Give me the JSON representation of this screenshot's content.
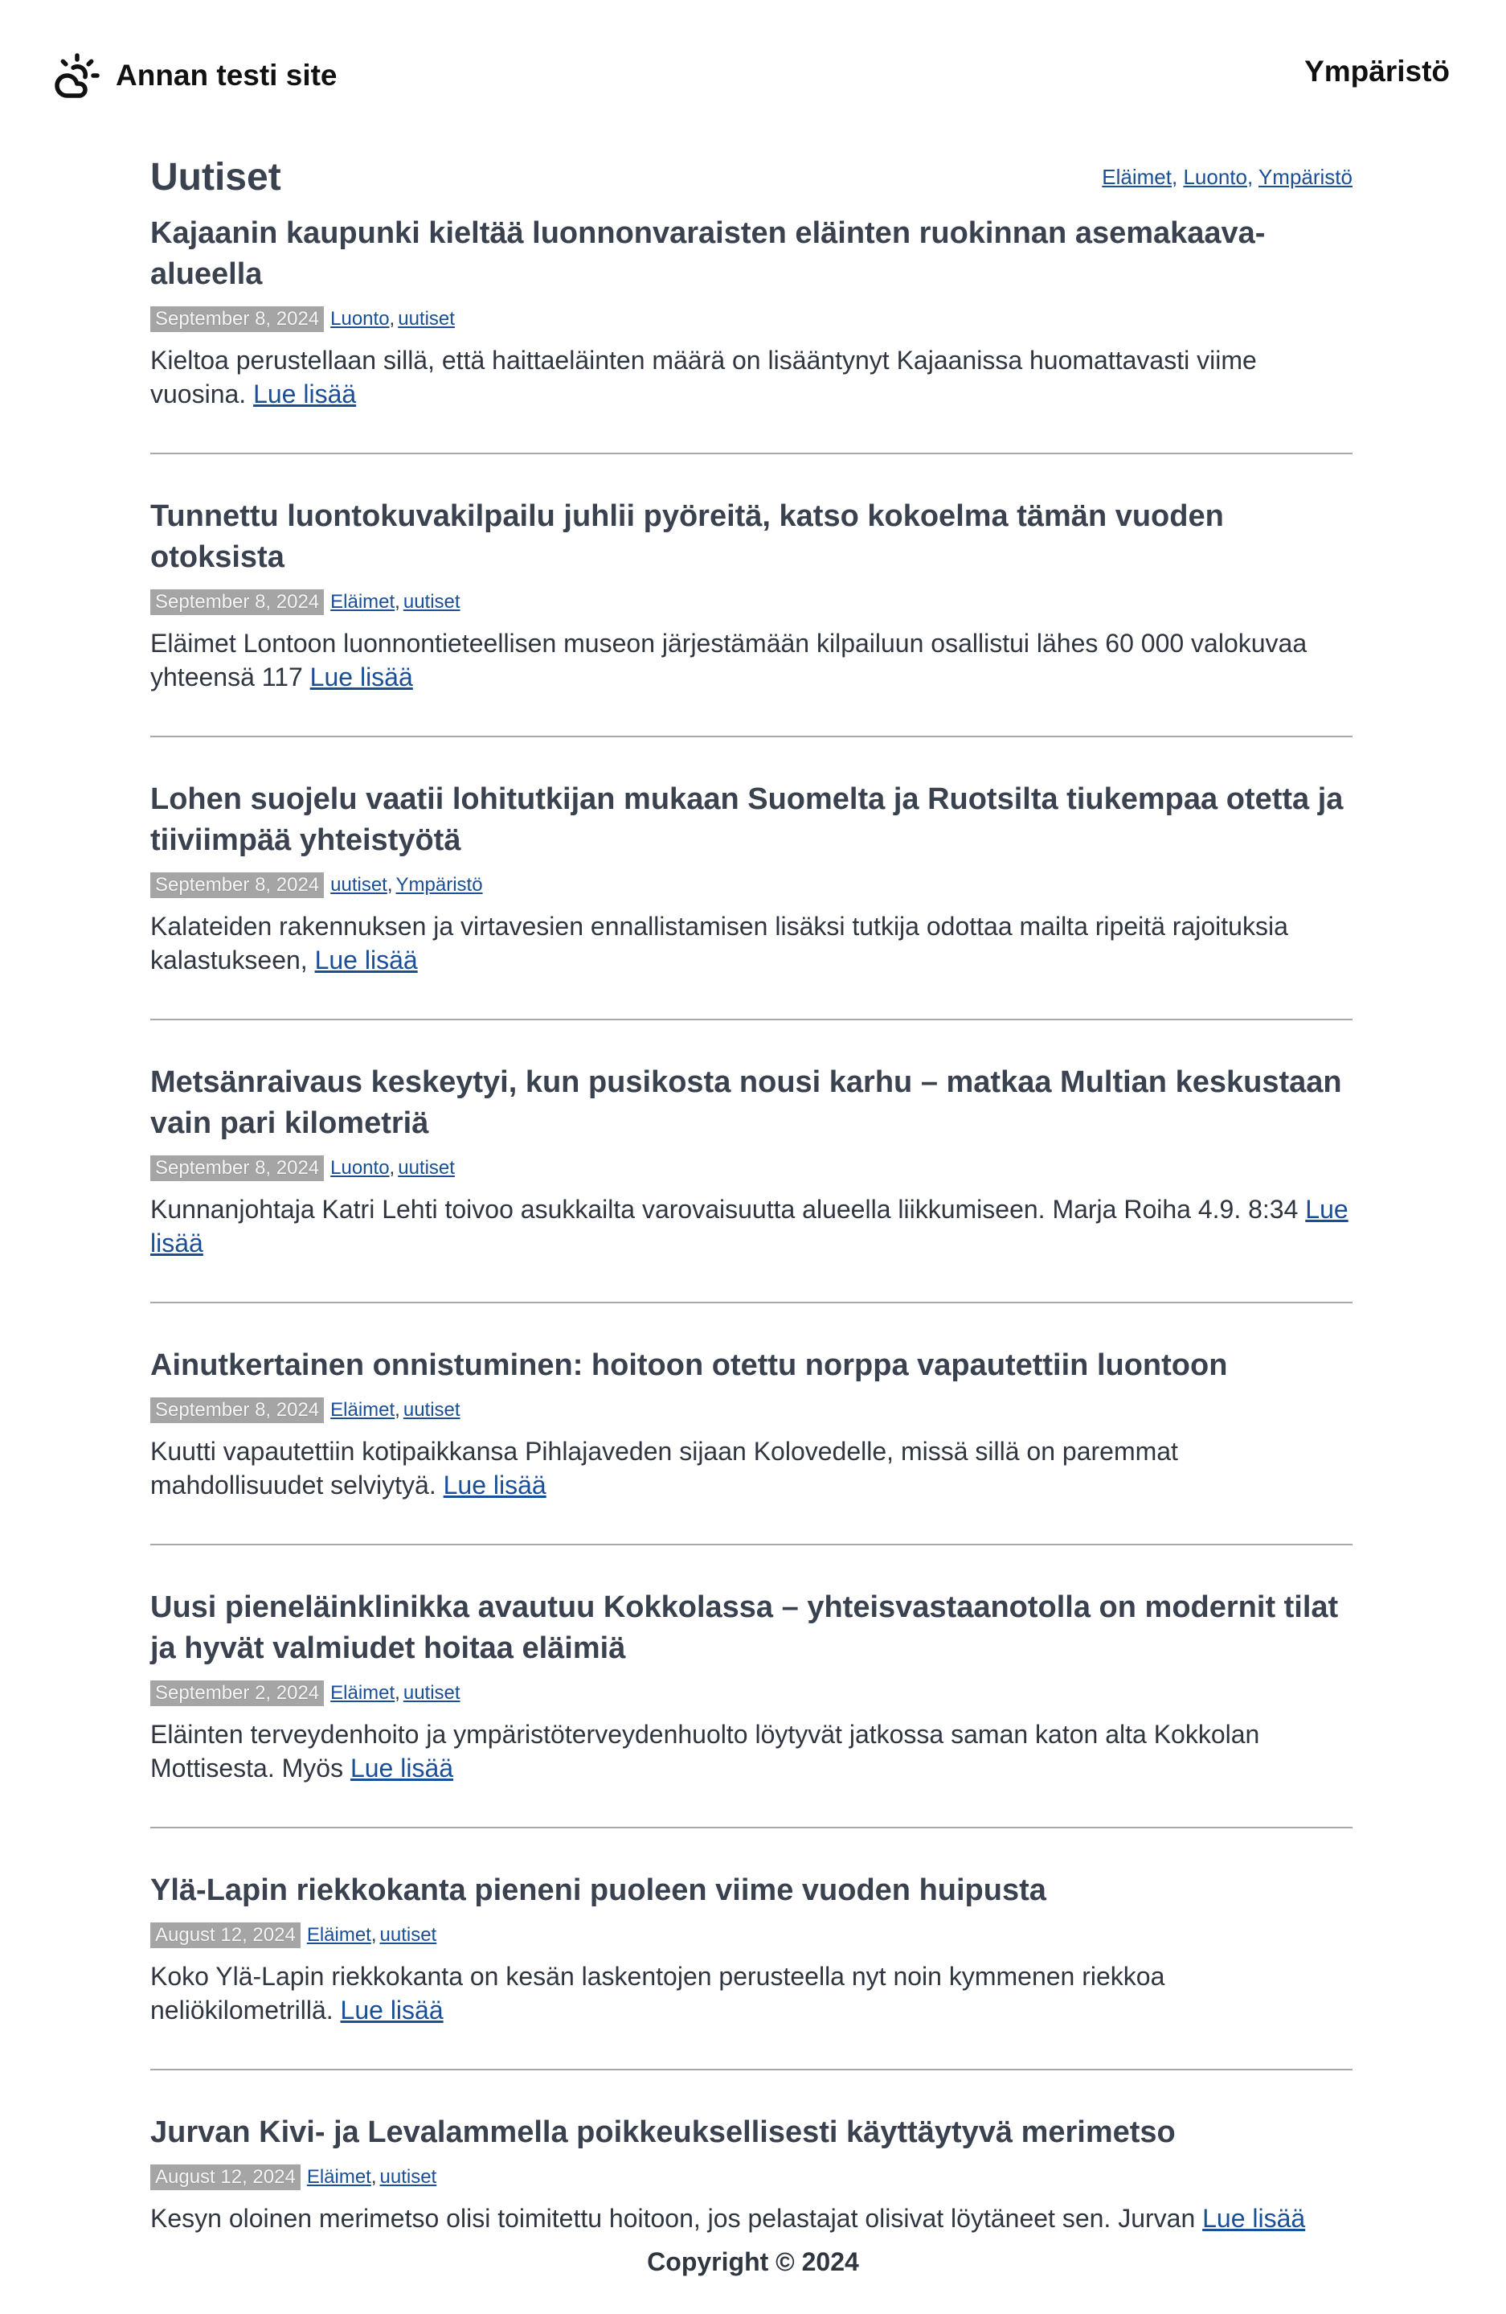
{
  "header": {
    "site_name": "Annan testi site",
    "logo_icon": "cloud-sun-icon",
    "nav_label": "Ympäristö"
  },
  "page": {
    "title": "Uutiset",
    "tags": [
      "Eläimet",
      "Luonto",
      "Ympäristö"
    ]
  },
  "read_more_label": "Lue lisää",
  "posts": [
    {
      "title": "Kajaanin kaupunki kieltää luonnonvaraisten eläinten ruokinnan asemakaava-alueella",
      "date": "September 8, 2024",
      "tags": [
        "Luonto",
        "uutiset"
      ],
      "excerpt": "Kieltoa perustellaan sillä, että haittaeläinten määrä on lisääntynyt Kajaanissa huomattavasti viime vuosina."
    },
    {
      "title": "Tunnettu luontokuvakilpailu juhlii pyöreitä, katso kokoelma tämän vuoden otoksista",
      "date": "September 8, 2024",
      "tags": [
        "Eläimet",
        "uutiset"
      ],
      "excerpt": "Eläimet Lontoon luonnontieteellisen museon järjestämään kilpailuun osallistui lähes 60 000 valokuvaa yhteensä 117"
    },
    {
      "title": "Lohen suojelu vaatii lohitutkijan mukaan Suomelta ja Ruotsilta tiukempaa otetta ja tiiviimpää yhteistyötä",
      "date": "September 8, 2024",
      "tags": [
        "uutiset",
        "Ympäristö"
      ],
      "excerpt": "Kalateiden rakennuksen ja virtavesien ennallistamisen lisäksi tutkija odottaa mailta ripeitä rajoituksia kalastukseen,"
    },
    {
      "title": "Metsänraivaus keskeytyi, kun pusikosta nousi karhu – matkaa Multian keskustaan vain pari kilometriä",
      "date": "September 8, 2024",
      "tags": [
        "Luonto",
        "uutiset"
      ],
      "excerpt": "Kunnanjohtaja Katri Lehti toivoo asukkailta varovaisuutta alueella liikkumiseen. Marja Roiha 4.9. 8:34"
    },
    {
      "title": "Ainutkertainen onnistuminen: hoitoon otettu norppa vapautettiin luontoon",
      "date": "September 8, 2024",
      "tags": [
        "Eläimet",
        "uutiset"
      ],
      "excerpt": "Kuutti vapautettiin kotipaikkansa Pihlajaveden sijaan Kolovedelle, missä sillä on paremmat mahdollisuudet selviytyä."
    },
    {
      "title": "Uusi pieneläinklinikka avautuu Kokkolassa – yhteisvastaanotolla on modernit tilat ja hyvät valmiudet hoitaa eläimiä",
      "date": "September 2, 2024",
      "tags": [
        "Eläimet",
        "uutiset"
      ],
      "excerpt": "Eläinten terveydenhoito ja ympäristöterveydenhuolto löytyvät jatkossa saman katon alta Kokkolan Mottisesta. Myös"
    },
    {
      "title": "Ylä-Lapin riekkokanta pieneni puoleen viime vuoden huipusta",
      "date": "August 12, 2024",
      "tags": [
        "Eläimet",
        "uutiset"
      ],
      "excerpt": "Koko Ylä-Lapin riekkokanta on kesän laskentojen perusteella nyt noin kymmenen riekkoa neliökilometrillä."
    },
    {
      "title": "Jurvan Kivi- ja Levalammella poikkeuksellisesti käyttäytyvä merimetso",
      "date": "August 12, 2024",
      "tags": [
        "Eläimet",
        "uutiset"
      ],
      "excerpt": "Kesyn oloinen merimetso olisi toimitettu hoitoon, jos pelastajat olisivat löytäneet sen. Jurvan"
    }
  ],
  "footer": {
    "copyright": "Copyright © 2024"
  }
}
